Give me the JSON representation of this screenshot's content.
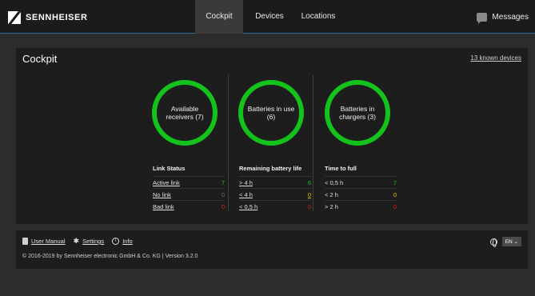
{
  "brand": {
    "name": "SENNHEISER"
  },
  "nav": {
    "tabs": [
      {
        "label": "Cockpit",
        "active": true
      },
      {
        "label": "Devices",
        "active": false
      },
      {
        "label": "Locations",
        "active": false
      }
    ],
    "messages_label": "Messages"
  },
  "cockpit": {
    "title": "Cockpit",
    "known_devices": "13 known devices",
    "gauges": [
      {
        "label": "Available receivers (7)",
        "color": "#14c21c"
      },
      {
        "label": "Batteries in use (6)",
        "color": "#14c21c"
      },
      {
        "label": "Batteries in chargers (3)",
        "color": "#14c21c"
      }
    ],
    "link_status": {
      "heading": "Link Status",
      "rows": [
        {
          "label": "Active link",
          "value": "7"
        },
        {
          "label": "No link",
          "value": "0"
        },
        {
          "label": "Bad link",
          "value": "0"
        }
      ]
    },
    "battery_life": {
      "heading": "Remaining battery life",
      "rows": [
        {
          "label": "> 4 h",
          "value": "6"
        },
        {
          "label": "< 4 h",
          "value": "0"
        },
        {
          "label": "< 0,5 h",
          "value": "0"
        }
      ]
    },
    "time_to_full": {
      "heading": "Time to full",
      "rows": [
        {
          "label": "< 0,5 h",
          "value": "7"
        },
        {
          "label": "< 2 h",
          "value": "0"
        },
        {
          "label": "> 2 h",
          "value": "0"
        }
      ]
    }
  },
  "footer": {
    "user_manual": "User Manual",
    "settings": "Settings",
    "info": "Info",
    "copyright": "© 2016-2019 by Sennheiser electronic GmbH & Co. KG | Version 3.2.0",
    "language": "EN ⌄"
  },
  "colors": {
    "accent": "#2f6f9a",
    "ok": "#18c21e",
    "warn": "#e0c000",
    "error": "#e31b1b"
  }
}
